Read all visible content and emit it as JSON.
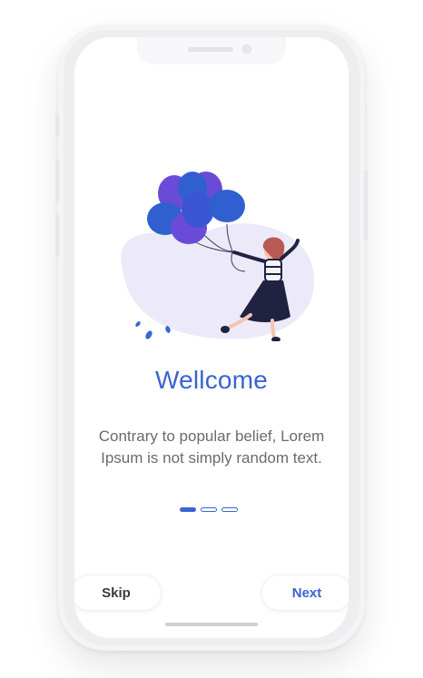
{
  "onboarding": {
    "title": "Wellcome",
    "description": "Contrary to popular belief, Lorem Ipsum is not simply random text.",
    "pager": {
      "total": 3,
      "active_index": 0
    },
    "skip_label": "Skip",
    "next_label": "Next"
  },
  "icons": {
    "illustration": "woman-with-balloons-illustration"
  },
  "colors": {
    "accent": "#3a64d2",
    "balloon_blue": "#3060d0",
    "balloon_purple": "#6a4bd8",
    "blob": "#eceaf8",
    "text_muted": "#6b6b6b"
  }
}
